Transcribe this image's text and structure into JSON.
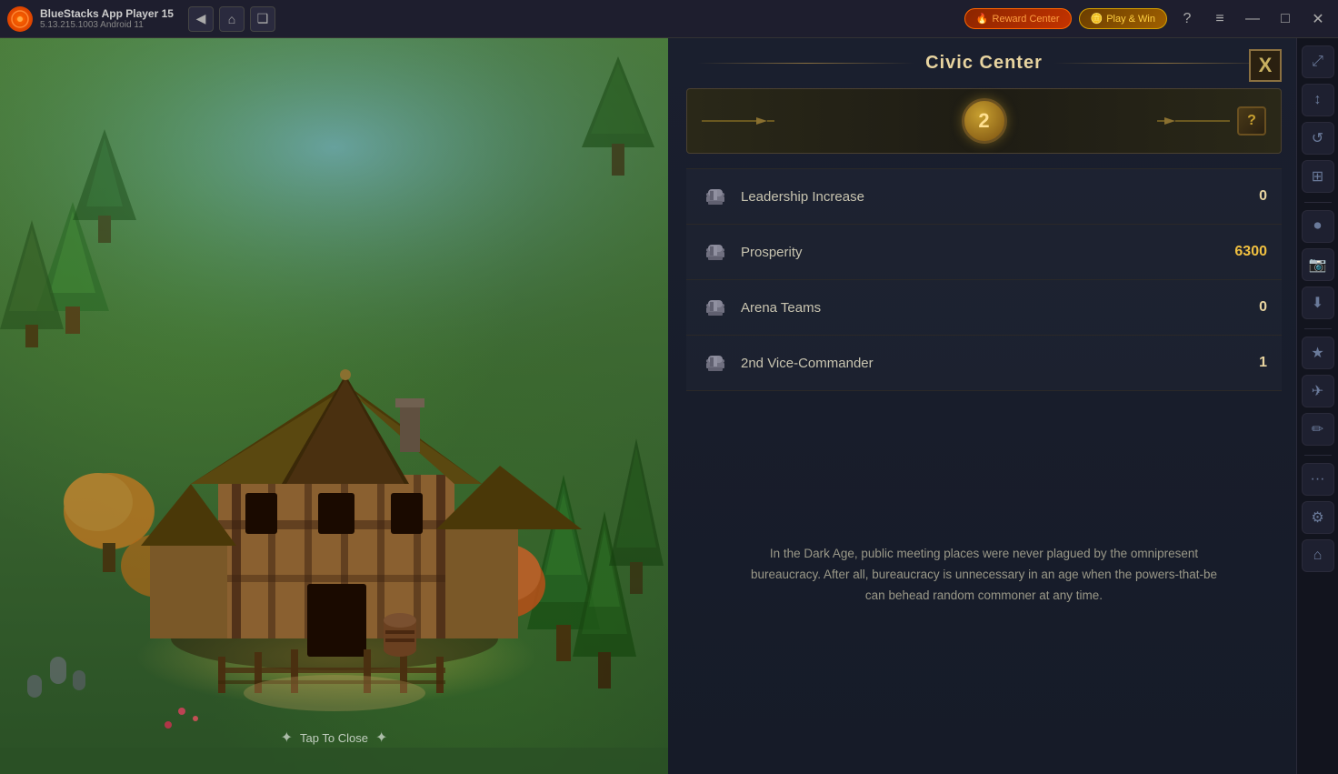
{
  "titlebar": {
    "app_name": "BlueStacks App Player 15",
    "version": "5.13.215.1003  Android 11",
    "logo_text": "BS",
    "back_icon": "◀",
    "home_icon": "⌂",
    "multi_icon": "❑",
    "reward_center_label": "Reward Center",
    "play_win_label": "Play & Win",
    "help_icon": "?",
    "menu_icon": "≡",
    "minimize_icon": "—",
    "maximize_icon": "□",
    "close_icon": "✕"
  },
  "sidebar": {
    "icons": [
      {
        "name": "expand-icon",
        "symbol": "⤢"
      },
      {
        "name": "arrows-icon",
        "symbol": "↕"
      },
      {
        "name": "rotate-icon",
        "symbol": "↺"
      },
      {
        "name": "layers-icon",
        "symbol": "⊞"
      },
      {
        "name": "record-icon",
        "symbol": "⏺"
      },
      {
        "name": "camera-icon",
        "symbol": "📷"
      },
      {
        "name": "download-icon",
        "symbol": "⬇"
      },
      {
        "name": "star-icon",
        "symbol": "★"
      },
      {
        "name": "fly-icon",
        "symbol": "✈"
      },
      {
        "name": "brush-icon",
        "symbol": "✏"
      },
      {
        "name": "settings-icon",
        "symbol": "⚙"
      },
      {
        "name": "home2-icon",
        "symbol": "⌂"
      }
    ]
  },
  "game": {
    "tap_to_close": "Tap To Close",
    "tap_icon": "✦"
  },
  "panel": {
    "title": "Civic Center",
    "close_btn": "X",
    "level": "2",
    "help_symbol": "?",
    "stats": [
      {
        "name": "Leadership Increase",
        "value": "0",
        "value_class": ""
      },
      {
        "name": "Prosperity",
        "value": "6300",
        "value_class": "gold"
      },
      {
        "name": "Arena Teams",
        "value": "0",
        "value_class": ""
      },
      {
        "name": "2nd Vice-Commander",
        "value": "1",
        "value_class": ""
      }
    ],
    "description": "In the Dark Age, public meeting places were never plagued by the omnipresent bureaucracy. After all, bureaucracy is unnecessary in an age when the powers-that-be can behead random commoner at any time."
  }
}
